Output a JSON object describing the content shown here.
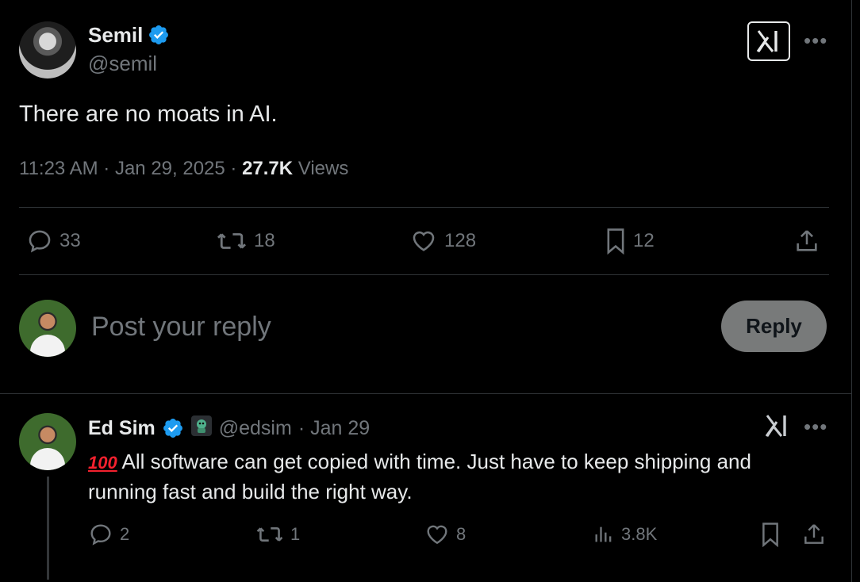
{
  "tweet": {
    "author": {
      "name": "Semil",
      "handle": "@semil",
      "verified": true
    },
    "text": "There are no moats in AI.",
    "time": "11:23 AM · Jan 29, 2025 · ",
    "views_count": "27.7K",
    "views_label": " Views",
    "actions": {
      "replies": "33",
      "reposts": "18",
      "likes": "128",
      "bookmarks": "12"
    }
  },
  "composer": {
    "placeholder": "Post your reply",
    "button_label": "Reply"
  },
  "reply": {
    "author": {
      "name": "Ed Sim",
      "handle": "@edsim",
      "date": "· Jan 29",
      "verified": true
    },
    "emoji": "100",
    "text": "All software can get copied with time. Just have to keep shipping and running fast and build the right way.",
    "actions": {
      "replies": "2",
      "reposts": "1",
      "likes": "8",
      "views": "3.8K"
    }
  },
  "icons": {
    "more": "more-icon",
    "grok": "grok-icon"
  },
  "colors": {
    "background": "#000000",
    "text": "#e7e9ea",
    "muted": "#71767b",
    "verified": "#1d9bf0",
    "divider": "#2f3336",
    "reply_button_bg": "#787a7a"
  }
}
